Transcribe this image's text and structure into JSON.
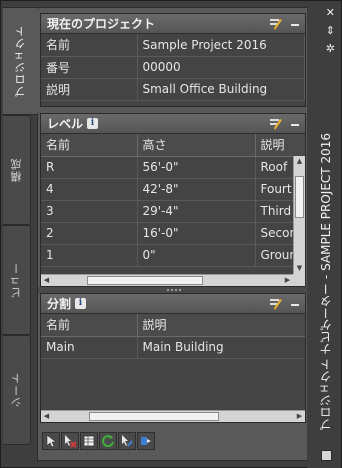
{
  "side_tabs": [
    {
      "label": "プロジェクト",
      "active": true
    },
    {
      "label": "構成",
      "active": false
    },
    {
      "label": "ビュー",
      "active": false
    },
    {
      "label": "シート",
      "active": false
    }
  ],
  "palette_title": "プロジェクト ナビゲーター - SAMPLE PROJECT 2016",
  "current_project": {
    "title": "現在のプロジェクト",
    "rows": [
      {
        "key": "名前",
        "value": "Sample Project 2016"
      },
      {
        "key": "番号",
        "value": "00000"
      },
      {
        "key": "説明",
        "value": "Small Office Building"
      }
    ]
  },
  "levels": {
    "title": "レベル",
    "columns": [
      "名前",
      "高さ",
      "説明"
    ],
    "rows": [
      {
        "name": "R",
        "height": "56'-0\"",
        "desc": "Roof"
      },
      {
        "name": "4",
        "height": "42'-8\"",
        "desc": "Fourt"
      },
      {
        "name": "3",
        "height": "29'-4\"",
        "desc": "Third"
      },
      {
        "name": "2",
        "height": "16'-0\"",
        "desc": "Secor"
      },
      {
        "name": "1",
        "height": "0\"",
        "desc": "Groun"
      }
    ]
  },
  "divisions": {
    "title": "分割",
    "columns": [
      "名前",
      "説明"
    ],
    "rows": [
      {
        "name": "Main",
        "desc": "Main Building"
      }
    ]
  },
  "toolbar_icons": [
    "select-icon",
    "delete-icon",
    "table-icon",
    "refresh-icon",
    "repath-icon",
    "synchronize-icon"
  ],
  "colors": {
    "panel": "#595959",
    "section": "#444444",
    "scroll": "#d4d4d4",
    "accent_green": "#3fae3a",
    "accent_blue": "#3a7ed6",
    "accent_red": "#d43a3a"
  }
}
